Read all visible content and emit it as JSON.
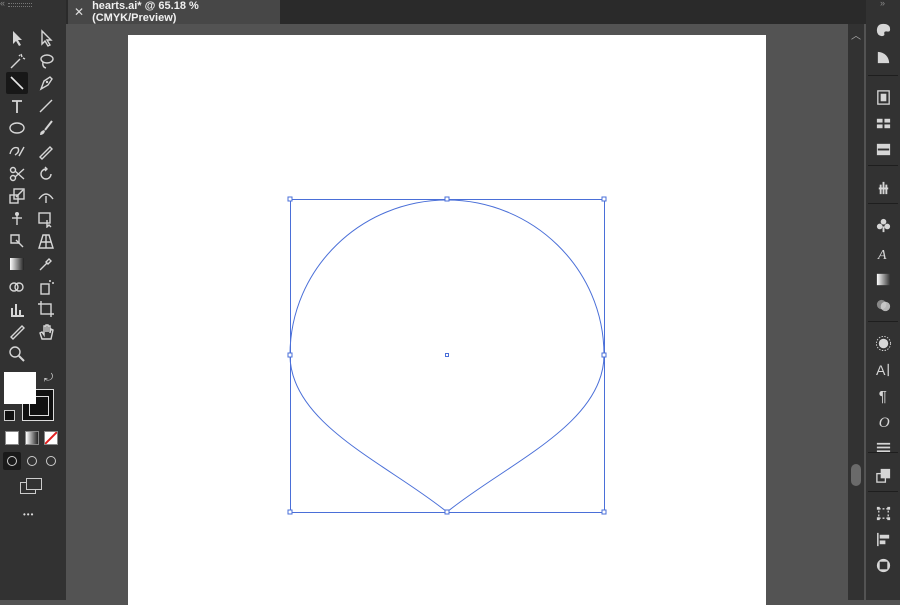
{
  "document": {
    "tab_title": "hearts.ai* @ 65.18 % (CMYK/Preview)",
    "close_glyph": "✕"
  },
  "toolbar": {
    "collapse_glyph": "«",
    "more_glyph": "•••",
    "tools": [
      "selection-tool",
      "direct-selection-tool",
      "magic-wand-tool",
      "lasso-tool",
      "line-segment-tool",
      "pen-tool",
      "type-tool",
      "line-tool",
      "ellipse-tool",
      "paintbrush-tool",
      "shaper-tool",
      "pencil-tool",
      "scissors-tool",
      "rotate-tool",
      "scale-tool",
      "width-tool",
      "puppet-warp-tool",
      "free-transform-tool",
      "shape-builder-tool",
      "perspective-grid-tool",
      "gradient-tool",
      "eyedropper-tool",
      "blend-tool",
      "symbol-sprayer-tool",
      "column-graph-tool",
      "artboard-tool",
      "slice-tool",
      "hand-tool",
      "zoom-tool"
    ],
    "fill_color": "#ffffff",
    "stroke_color": "#000000"
  },
  "right_panel": {
    "collapse_glyph": "»",
    "icons": [
      "color-icon",
      "color-guide-icon",
      "libraries-icon",
      "swatches-icon",
      "brushes-icon",
      "symbols-icon",
      "graphic-styles-icon",
      "character-styles-icon",
      "gradient-icon",
      "transparency-icon",
      "appearance-icon",
      "character-icon",
      "paragraph-icon",
      "opentype-icon",
      "stroke-icon",
      "layers-icon",
      "transform-icon",
      "align-icon",
      "pathfinder-icon"
    ]
  },
  "scrollbar": {
    "up_glyph": "︿"
  },
  "colors": {
    "selection": "#4a6fd8",
    "canvas_bg": "#535353",
    "panel_bg": "#323232"
  }
}
